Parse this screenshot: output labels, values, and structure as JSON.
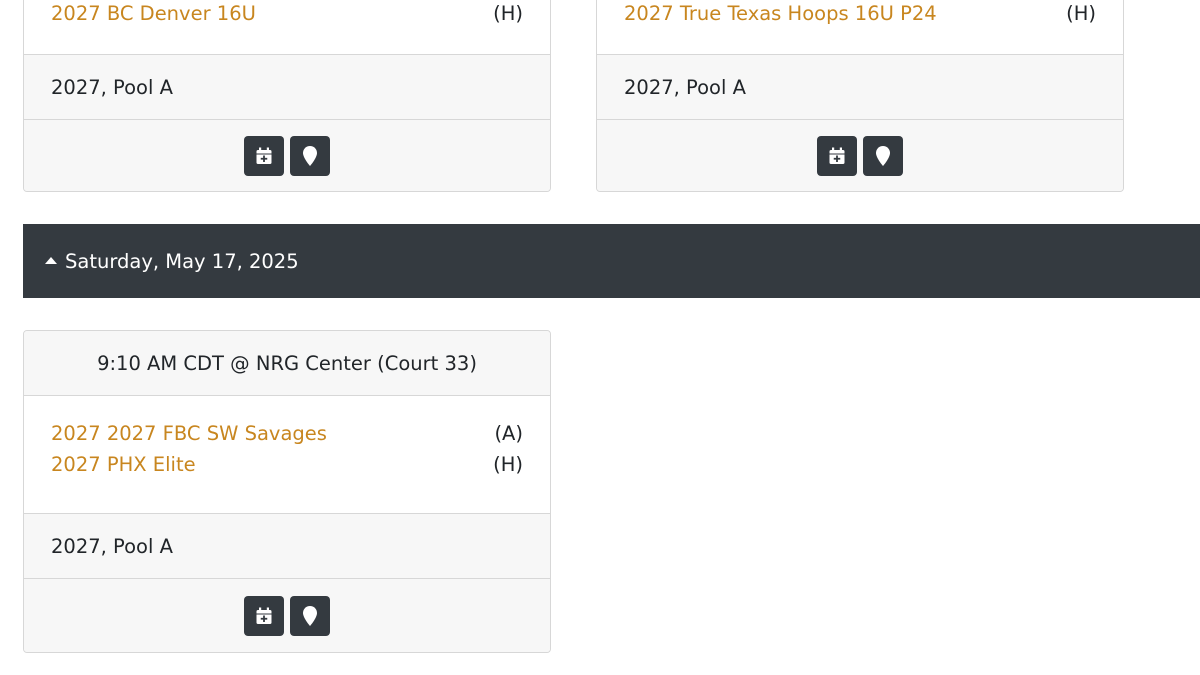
{
  "top_cards": [
    {
      "team": "2027 BC Denver 16U",
      "home_away": "(H)",
      "pool": "2027, Pool A"
    },
    {
      "team": "2027 True Texas Hoops 16U P24",
      "home_away": "(H)",
      "pool": "2027, Pool A"
    }
  ],
  "day": {
    "label": "Saturday, May 17, 2025"
  },
  "game": {
    "header": "9:10 AM CDT @ NRG Center (Court 33)",
    "teams": [
      {
        "name": "2027 2027 FBC SW Savages",
        "home_away": "(A)"
      },
      {
        "name": "2027 PHX Elite",
        "home_away": "(H)"
      }
    ],
    "pool": "2027, Pool A"
  },
  "icons": {
    "calendar": "calendar-plus-icon",
    "location": "map-marker-icon"
  },
  "colors": {
    "team_link": "#c8861f",
    "dark": "#343a40",
    "panel": "#f7f7f7"
  }
}
